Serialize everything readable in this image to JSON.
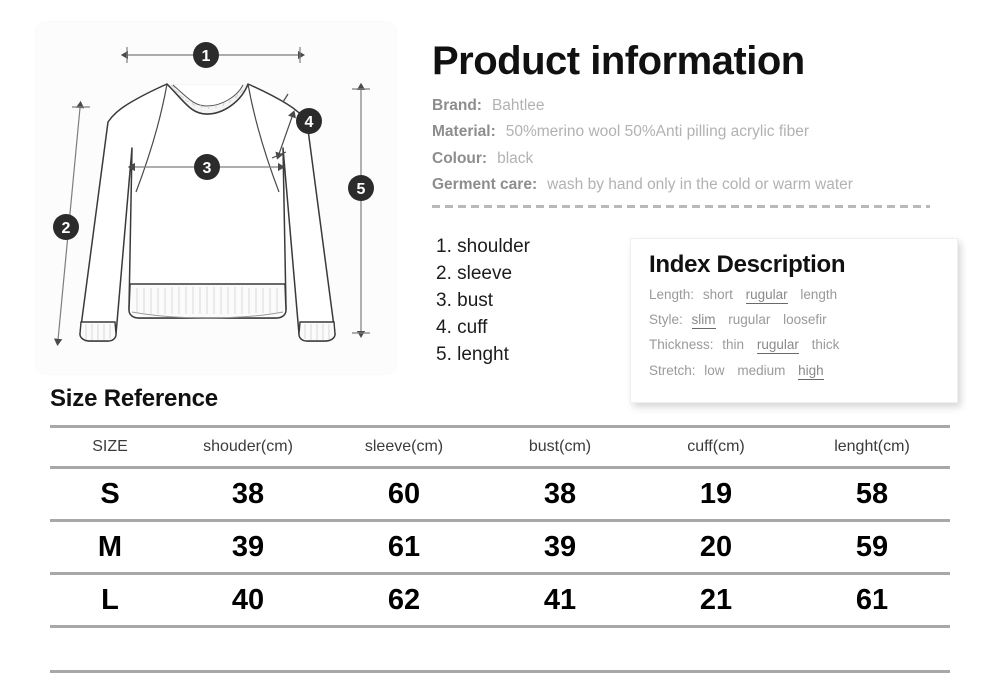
{
  "product": {
    "title": "Product information",
    "specs": [
      {
        "label": "Brand:",
        "value": "Bahtlee"
      },
      {
        "label": "Material:",
        "value": "50%merino wool 50%Anti pilling acrylic fiber"
      },
      {
        "label": "Colour:",
        "value": "black"
      },
      {
        "label": "Germent care:",
        "value": "wash by hand only in the cold or warm water"
      }
    ]
  },
  "measurement_legend": [
    "1. shoulder",
    "2. sleeve",
    "3. bust",
    "4. cuff",
    "5. lenght"
  ],
  "diagram": {
    "markers": [
      {
        "id": "1",
        "measures": "shoulder"
      },
      {
        "id": "2",
        "measures": "sleeve"
      },
      {
        "id": "3",
        "measures": "bust"
      },
      {
        "id": "4",
        "measures": "cuff"
      },
      {
        "id": "5",
        "measures": "lenght"
      }
    ],
    "marker_fill": "#2b2b2b",
    "marker_text_color": "#ffffff",
    "garment": "crewneck-sweater"
  },
  "index_description": {
    "title": "Index Description",
    "rows": [
      {
        "label": "Length:",
        "options": [
          "short",
          "rugular",
          "length"
        ],
        "selected": "rugular"
      },
      {
        "label": "Style:",
        "options": [
          "slim",
          "rugular",
          "loosefir"
        ],
        "selected": "slim"
      },
      {
        "label": "Thickness:",
        "options": [
          "thin",
          "rugular",
          "thick"
        ],
        "selected": "rugular"
      },
      {
        "label": "Stretch:",
        "options": [
          "low",
          "medium",
          "high"
        ],
        "selected": "high"
      }
    ]
  },
  "size_reference": {
    "heading": "Size Reference",
    "columns": [
      "SIZE",
      "shouder(cm)",
      "sleeve(cm)",
      "bust(cm)",
      "cuff(cm)",
      "lenght(cm)"
    ],
    "rows": [
      [
        "S",
        "38",
        "60",
        "38",
        "19",
        "58"
      ],
      [
        "M",
        "39",
        "61",
        "39",
        "20",
        "59"
      ],
      [
        "L",
        "40",
        "62",
        "41",
        "21",
        "61"
      ],
      [
        "",
        "",
        "",
        "",
        "",
        ""
      ]
    ]
  }
}
